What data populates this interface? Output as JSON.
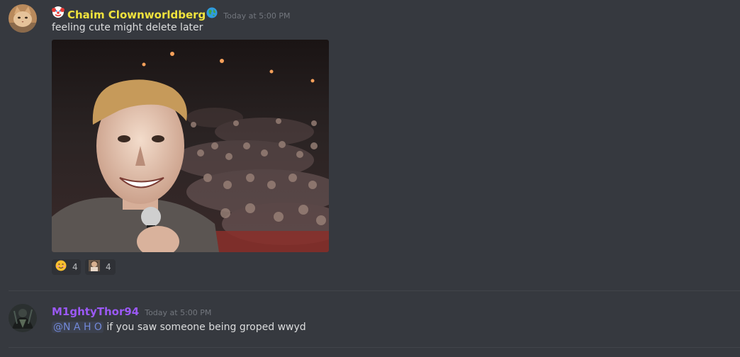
{
  "messages": [
    {
      "username": "Chaim Clownworldberg",
      "username_color": "#f1e33d",
      "prefix_icon": "clown-face-icon",
      "suffix_icon": "globe-icon",
      "timestamp": "Today at 5:00 PM",
      "text": "feeling cute might delete later",
      "attachment_icon": "selfie-photo-icon",
      "reactions": [
        {
          "icon": "smiling-face-icon",
          "count": "4"
        },
        {
          "icon": "custom-emoji-icon",
          "count": "4"
        }
      ]
    },
    {
      "username": "M1ghtyThor94",
      "username_color": "#9b59f6",
      "timestamp": "Today at 5:00 PM",
      "mention": "@N A H O",
      "text": " if you saw someone being groped wwyd"
    }
  ],
  "colors": {
    "background": "#36393f",
    "text": "#dcddde",
    "timestamp": "#72767d",
    "mention": "#7289da"
  }
}
